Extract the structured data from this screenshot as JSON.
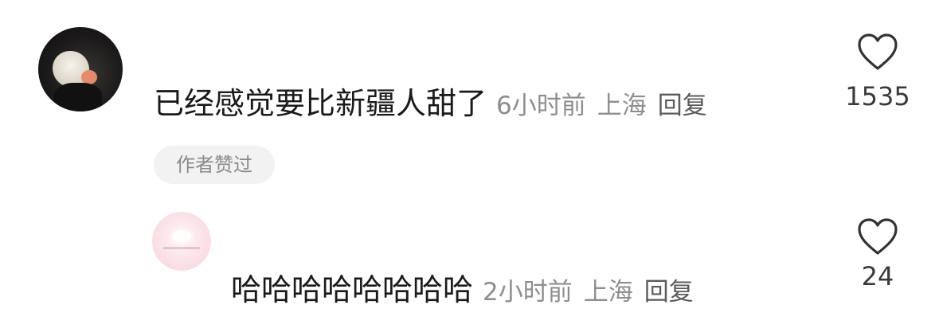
{
  "comments": [
    {
      "text": "已经感觉要比新疆人甜了",
      "time": "6小时前",
      "location": "上海",
      "reply_label": "回复",
      "likes": "1535",
      "badge": "作者赞过"
    },
    {
      "text": "哈哈哈哈哈哈哈哈",
      "time": "2小时前",
      "location": "上海",
      "reply_label": "回复",
      "likes": "24"
    }
  ],
  "icons": {
    "like": "heart-outline-icon"
  },
  "colors": {
    "meta": "#8e8e8e",
    "badge_bg": "#f2f2f2",
    "text": "#1a1a1a"
  }
}
